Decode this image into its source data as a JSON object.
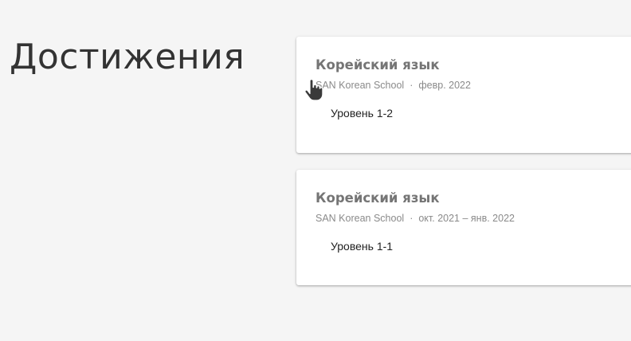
{
  "section": {
    "title": "Достижения"
  },
  "achievements": [
    {
      "title": "Корейский язык",
      "issuer": "SAN Korean School",
      "separator": "·",
      "date": "февр. 2022",
      "level": "Уровень 1-2"
    },
    {
      "title": "Корейский язык",
      "issuer": "SAN Korean School",
      "separator": "·",
      "date": "окт. 2021 – янв. 2022",
      "level": "Уровень 1-1"
    }
  ],
  "cursor": {
    "icon": "hand-pointer-icon"
  },
  "colors": {
    "background": "#f5f5f5",
    "card": "#ffffff",
    "title_text": "#333333",
    "card_title": "#757575",
    "meta_text": "#8a8a8a",
    "level_text": "#222222"
  }
}
